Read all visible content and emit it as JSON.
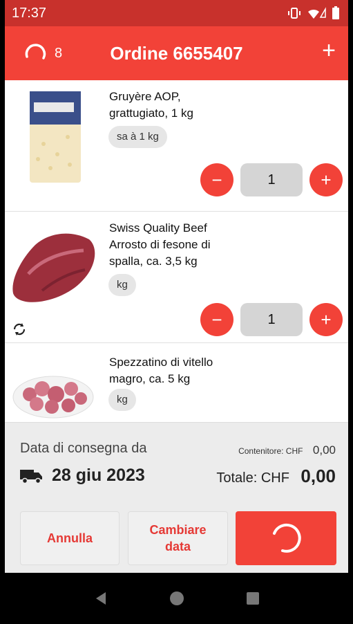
{
  "status_bar": {
    "time": "17:37"
  },
  "header": {
    "pending_count": "8",
    "title": "Ordine 6655407",
    "add_symbol": "+"
  },
  "items": [
    {
      "name": "Gruyère AOP, grattugiato, 1 kg",
      "unit": "sa à 1 kg",
      "quantity": "1"
    },
    {
      "name": "Swiss Quality Beef Arrosto di fesone di spalla, ca. 3,5 kg",
      "unit": "kg",
      "quantity": "1",
      "substitution_icon": "refresh-icon"
    },
    {
      "name": "Spezzatino di vitello magro, ca. 5 kg",
      "unit": "kg"
    }
  ],
  "summary": {
    "delivery_label": "Data di consegna da",
    "delivery_date": "28 giu 2023",
    "container_label": "Contenitore: CHF",
    "container_value": "0,00",
    "total_label": "Totale: CHF",
    "total_value": "0,00"
  },
  "buttons": {
    "cancel": "Annulla",
    "change_date_line1": "Cambiare",
    "change_date_line2": "data"
  },
  "symbols": {
    "minus": "−",
    "plus": "+"
  },
  "colors": {
    "accent": "#f24238",
    "status_bar": "#c8312c",
    "summary_bg": "#ececec"
  }
}
